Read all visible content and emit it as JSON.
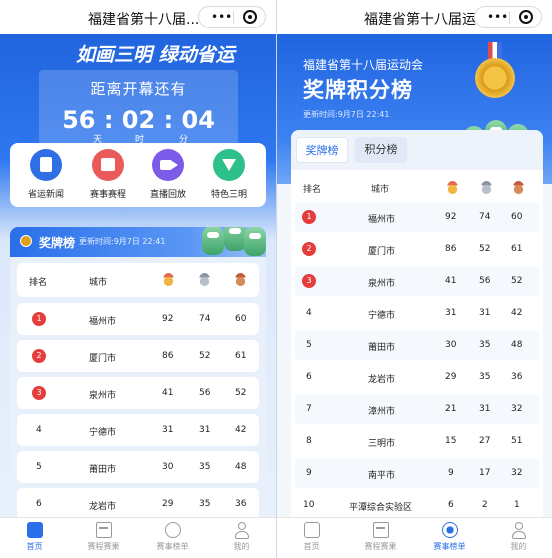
{
  "left": {
    "app_title": "福建省第十八届...",
    "slogan": "如画三明 绿动省运",
    "countdown": {
      "title": "距离开幕还有",
      "days": "56",
      "hours": "02",
      "minutes": "04",
      "unit_day": "天",
      "unit_hour": "时",
      "unit_min": "分"
    },
    "shortcuts": [
      {
        "label": "省运新闻",
        "icon": "news-icon"
      },
      {
        "label": "赛事赛程",
        "icon": "calendar-icon"
      },
      {
        "label": "直播回放",
        "icon": "video-icon"
      },
      {
        "label": "特色三明",
        "icon": "gem-icon"
      }
    ],
    "medal_panel": {
      "title": "奖牌榜",
      "updated": "更新时间:9月7日 22:41",
      "header": {
        "rank": "排名",
        "city": "城市"
      },
      "rows": [
        {
          "rank": "1",
          "city": "福州市",
          "gold": "92",
          "silver": "74",
          "bronze": "60"
        },
        {
          "rank": "2",
          "city": "厦门市",
          "gold": "86",
          "silver": "52",
          "bronze": "61"
        },
        {
          "rank": "3",
          "city": "泉州市",
          "gold": "41",
          "silver": "56",
          "bronze": "52"
        },
        {
          "rank": "4",
          "city": "宁德市",
          "gold": "31",
          "silver": "31",
          "bronze": "42"
        },
        {
          "rank": "5",
          "city": "莆田市",
          "gold": "30",
          "silver": "35",
          "bronze": "48"
        },
        {
          "rank": "6",
          "city": "龙岩市",
          "gold": "29",
          "silver": "35",
          "bronze": "36"
        }
      ]
    },
    "tabs": [
      {
        "label": "首页",
        "active": true
      },
      {
        "label": "赛程赛果",
        "active": false
      },
      {
        "label": "赛事榜单",
        "active": false
      },
      {
        "label": "我的",
        "active": false
      }
    ]
  },
  "right": {
    "app_title": "福建省第十八届运...",
    "subtitle": "福建省第十八届运动会",
    "title": "奖牌积分榜",
    "updated": "更新时间:9月7日 22:41",
    "tab_medal": "奖牌榜",
    "tab_points": "积分榜",
    "header": {
      "rank": "排名",
      "city": "城市"
    },
    "rows": [
      {
        "rank": "1",
        "city": "福州市",
        "gold": "92",
        "silver": "74",
        "bronze": "60"
      },
      {
        "rank": "2",
        "city": "厦门市",
        "gold": "86",
        "silver": "52",
        "bronze": "61"
      },
      {
        "rank": "3",
        "city": "泉州市",
        "gold": "41",
        "silver": "56",
        "bronze": "52"
      },
      {
        "rank": "4",
        "city": "宁德市",
        "gold": "31",
        "silver": "31",
        "bronze": "42"
      },
      {
        "rank": "5",
        "city": "莆田市",
        "gold": "30",
        "silver": "35",
        "bronze": "48"
      },
      {
        "rank": "6",
        "city": "龙岩市",
        "gold": "29",
        "silver": "35",
        "bronze": "36"
      },
      {
        "rank": "7",
        "city": "漳州市",
        "gold": "21",
        "silver": "31",
        "bronze": "32"
      },
      {
        "rank": "8",
        "city": "三明市",
        "gold": "15",
        "silver": "27",
        "bronze": "51"
      },
      {
        "rank": "9",
        "city": "南平市",
        "gold": "9",
        "silver": "17",
        "bronze": "32"
      },
      {
        "rank": "10",
        "city": "平潭综合实验区",
        "gold": "6",
        "silver": "2",
        "bronze": "1"
      }
    ],
    "tabs": [
      {
        "label": "首页",
        "active": false
      },
      {
        "label": "赛程赛果",
        "active": false
      },
      {
        "label": "赛事榜单",
        "active": true
      },
      {
        "label": "我的",
        "active": false
      }
    ]
  },
  "colors": {
    "brand_blue": "#2a6fe9",
    "rank_red": "#e53c3c",
    "gold": "#f2b542",
    "silver": "#b9bfc9",
    "bronze": "#d78b5a"
  }
}
